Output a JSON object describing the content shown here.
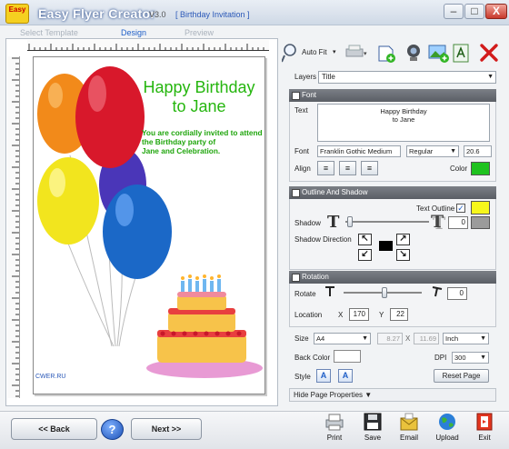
{
  "window": {
    "app_title": "Easy Flyer Creator",
    "version": "V3.0",
    "doc_title": "[ Birthday Invitation ]",
    "icon_text": "Easy",
    "min": "–",
    "max": "□",
    "close": "X"
  },
  "steps": [
    "Select Template",
    "Design",
    "Preview"
  ],
  "flyer": {
    "title_line1": "Happy Birthday",
    "title_line2": "to Jane",
    "body_line1": "You are cordially invited to attend",
    "body_line2": "the Birthday party of",
    "body_line3": "Jane and Celebration.",
    "watermark": "CWER.RU"
  },
  "toolbar": {
    "autofit_label": "Auto Fit"
  },
  "layers": {
    "label": "Layers",
    "value": "Title"
  },
  "font_section": {
    "header": "Font",
    "text_label": "Text",
    "text_line1": "Happy Birthday",
    "text_line2": "to Jane",
    "font_label": "Font",
    "font_value": "Franklin Gothic Medium",
    "style_value": "Regular",
    "size_value": "20.6",
    "align_label": "Align",
    "color_label": "Color",
    "color": "#1fc21f"
  },
  "outline_section": {
    "header": "Outline And Shadow",
    "text_outline_label": "Text Outline",
    "outline_checked": "✓",
    "outline_color": "#f6f71c",
    "shadow_label": "Shadow",
    "shadow_value": "0",
    "shadow_color": "#9b9b9b",
    "direction_label": "Shadow Direction"
  },
  "rotation_section": {
    "header": "Rotation",
    "rotate_label": "Rotate",
    "rotate_value": "0",
    "location_label": "Location",
    "x_label": "X",
    "x_value": "170",
    "y_label": "Y",
    "y_value": "22"
  },
  "page_props": {
    "size_label": "Size",
    "size_value": "A4",
    "width": "8.27",
    "x_label": "X",
    "height": "11.69",
    "unit": "Inch",
    "back_color_label": "Back Color",
    "dpi_label": "DPI",
    "dpi_value": "300",
    "style_label": "Style",
    "reset_label": "Reset Page",
    "hide_label": "Hide Page Properties ▼"
  },
  "bottom": {
    "back_label": "<< Back",
    "help_label": "?",
    "next_label": "Next >>",
    "actions": [
      "Print",
      "Save",
      "Email",
      "Upload",
      "Exit"
    ]
  }
}
